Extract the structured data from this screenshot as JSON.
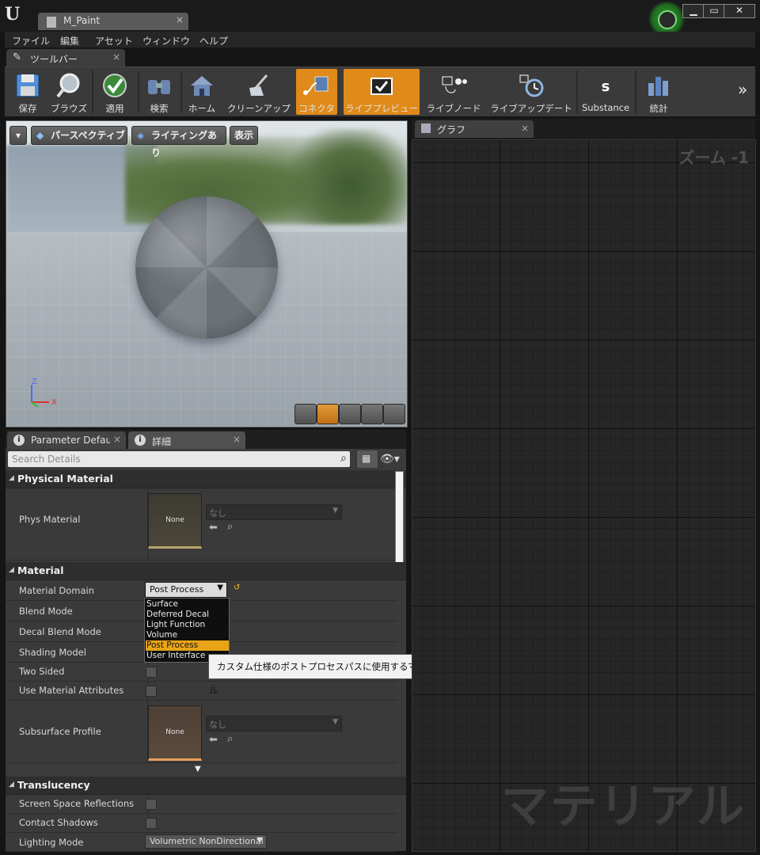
{
  "window": {
    "doc_tab": "M_Paint",
    "close_glyph": "×"
  },
  "menu": [
    "ファイル",
    "編集",
    "アセット",
    "ウィンドウ",
    "ヘルプ"
  ],
  "toolbar_tab": {
    "label": "ツールバー"
  },
  "toolbar": {
    "buttons": [
      {
        "label": "保存",
        "icon": "save-icon"
      },
      {
        "label": "ブラウズ",
        "icon": "browse-icon"
      },
      {
        "label": "適用",
        "icon": "apply-icon"
      },
      {
        "label": "検索",
        "icon": "search-icon"
      },
      {
        "label": "ホーム",
        "icon": "home-icon"
      },
      {
        "label": "クリーンアップ",
        "icon": "cleanup-icon"
      },
      {
        "label": "コネクタ",
        "icon": "connector-icon",
        "active": true
      },
      {
        "label": "ライブプレビュー",
        "icon": "live-preview-icon",
        "active": true
      },
      {
        "label": "ライブノード",
        "icon": "live-node-icon"
      },
      {
        "label": "ライブアップデート",
        "icon": "live-update-icon"
      },
      {
        "label": "Substance",
        "icon": "substance-icon"
      },
      {
        "label": "統計",
        "icon": "stats-icon"
      }
    ],
    "more_glyph": "»"
  },
  "viewport": {
    "perspective": "パースペクティブ",
    "lighting": "ライティングあり",
    "show": "表示",
    "axis_z": "Z",
    "axis_x": "X"
  },
  "details_tabs": [
    {
      "label": "Parameter Defaults"
    },
    {
      "label": "詳細"
    }
  ],
  "search": {
    "placeholder": "Search Details"
  },
  "sections": {
    "physical_material": "Physical Material",
    "material": "Material",
    "translucency": "Translucency"
  },
  "props": {
    "phys_material": "Phys Material",
    "phys_thumb": "None",
    "phys_asset": "なし",
    "material_domain": "Material Domain",
    "material_domain_value": "Post Process",
    "blend_mode": "Blend Mode",
    "decal_blend_mode": "Decal Blend Mode",
    "shading_model": "Shading Model",
    "two_sided": "Two Sided",
    "use_material_attributes": "Use Material Attributes",
    "subsurface_profile": "Subsurface Profile",
    "subsurface_thumb": "None",
    "subsurface_asset": "なし",
    "ssr": "Screen Space Reflections",
    "contact_shadows": "Contact Shadows",
    "lighting_mode": "Lighting Mode",
    "lighting_mode_value": "Volumetric NonDirectional"
  },
  "dropdown": {
    "options": [
      "Surface",
      "Deferred Decal",
      "Light Function",
      "Volume",
      "Post Process",
      "User Interface"
    ],
    "selected": "Post Process"
  },
  "tooltip": "カスタム仕様のポストプロセスパスに使用するマテリアル",
  "graph": {
    "tab": "グラフ",
    "zoom": "ズーム -1",
    "watermark": "マテリアル"
  },
  "colors": {
    "accent": "#e08a1a",
    "selected": "#e8a317"
  }
}
